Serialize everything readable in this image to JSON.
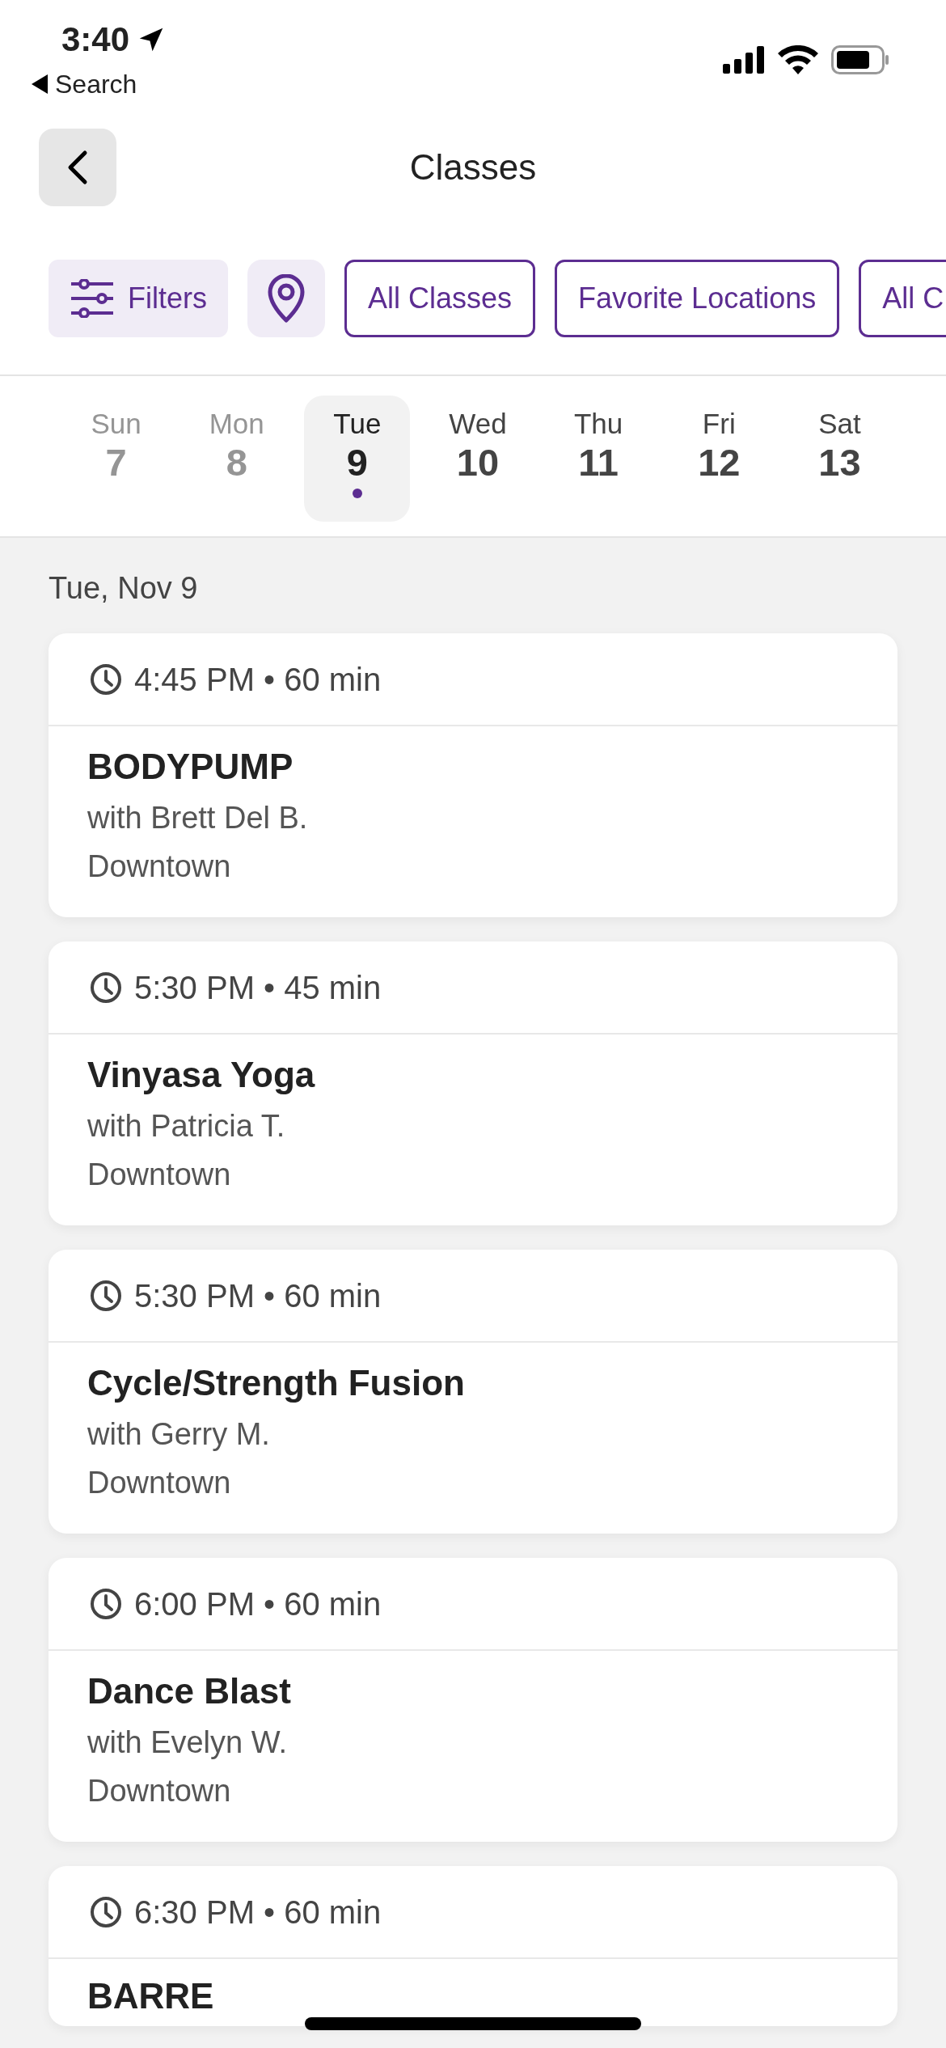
{
  "status_bar": {
    "time": "3:40",
    "back_label": "Search"
  },
  "header": {
    "title": "Classes"
  },
  "filters": [
    {
      "kind": "filter",
      "label": "Filters"
    },
    {
      "kind": "location"
    },
    {
      "kind": "chip",
      "label": "All Classes"
    },
    {
      "kind": "chip",
      "label": "Favorite Locations"
    },
    {
      "kind": "chip",
      "label": "All C"
    }
  ],
  "days": [
    {
      "weekday": "Sun",
      "date": "7",
      "disabled": true,
      "selected": false
    },
    {
      "weekday": "Mon",
      "date": "8",
      "disabled": true,
      "selected": false
    },
    {
      "weekday": "Tue",
      "date": "9",
      "disabled": false,
      "selected": true
    },
    {
      "weekday": "Wed",
      "date": "10",
      "disabled": false,
      "selected": false
    },
    {
      "weekday": "Thu",
      "date": "11",
      "disabled": false,
      "selected": false
    },
    {
      "weekday": "Fri",
      "date": "12",
      "disabled": false,
      "selected": false
    },
    {
      "weekday": "Sat",
      "date": "13",
      "disabled": false,
      "selected": false
    }
  ],
  "section_heading": "Tue, Nov 9",
  "classes": [
    {
      "time": "4:45 PM • 60 min",
      "title": "BODYPUMP",
      "instructor": "with Brett Del B.",
      "location": "Downtown"
    },
    {
      "time": "5:30 PM • 45 min",
      "title": "Vinyasa Yoga",
      "instructor": "with Patricia T.",
      "location": "Downtown"
    },
    {
      "time": "5:30 PM • 60 min",
      "title": "Cycle/Strength Fusion",
      "instructor": "with Gerry M.",
      "location": "Downtown"
    },
    {
      "time": "6:00 PM • 60 min",
      "title": "Dance Blast",
      "instructor": "with Evelyn W.",
      "location": "Downtown"
    },
    {
      "time": "6:30 PM • 60 min",
      "title": "BARRE"
    }
  ]
}
